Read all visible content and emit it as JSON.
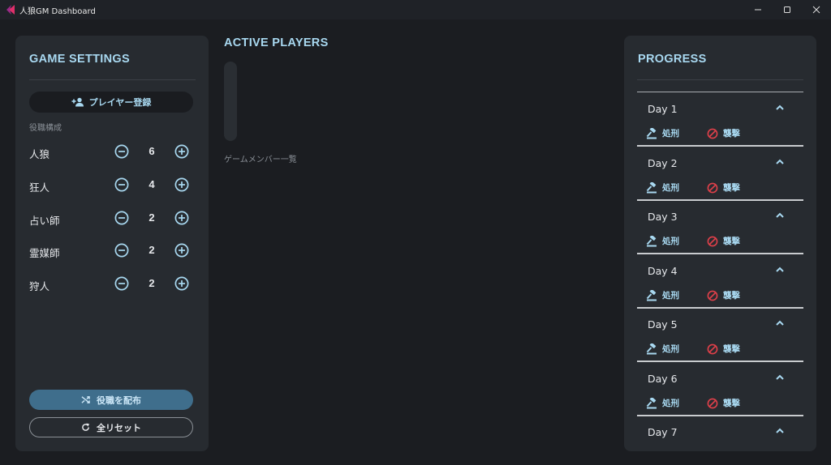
{
  "window": {
    "title": "人狼GM Dashboard",
    "accent": "#e0306a"
  },
  "settings": {
    "title": "GAME SETTINGS",
    "register_label": "プレイヤー登録",
    "roles_label": "役職構成",
    "roles": [
      {
        "name": "人狼",
        "count": "6"
      },
      {
        "name": "狂人",
        "count": "4"
      },
      {
        "name": "占い師",
        "count": "2"
      },
      {
        "name": "霊媒師",
        "count": "2"
      },
      {
        "name": "狩人",
        "count": "2"
      }
    ],
    "distribute_label": "役職を配布",
    "reset_label": "全リセット"
  },
  "players": {
    "title": "ACTIVE PLAYERS",
    "caption": "ゲームメンバー一覧"
  },
  "progress": {
    "title": "PROGRESS",
    "execute_label": "処刑",
    "attack_label": "襲撃",
    "days": [
      {
        "label": "Day 1"
      },
      {
        "label": "Day 2"
      },
      {
        "label": "Day 3"
      },
      {
        "label": "Day 4"
      },
      {
        "label": "Day 5"
      },
      {
        "label": "Day 6"
      },
      {
        "label": "Day 7"
      }
    ]
  },
  "colors": {
    "accent_text": "#a8d8f0",
    "attack_icon": "#e0404a",
    "primary_button": "#3f6e8c",
    "panel": "#272b30",
    "background": "#1b1d21"
  }
}
